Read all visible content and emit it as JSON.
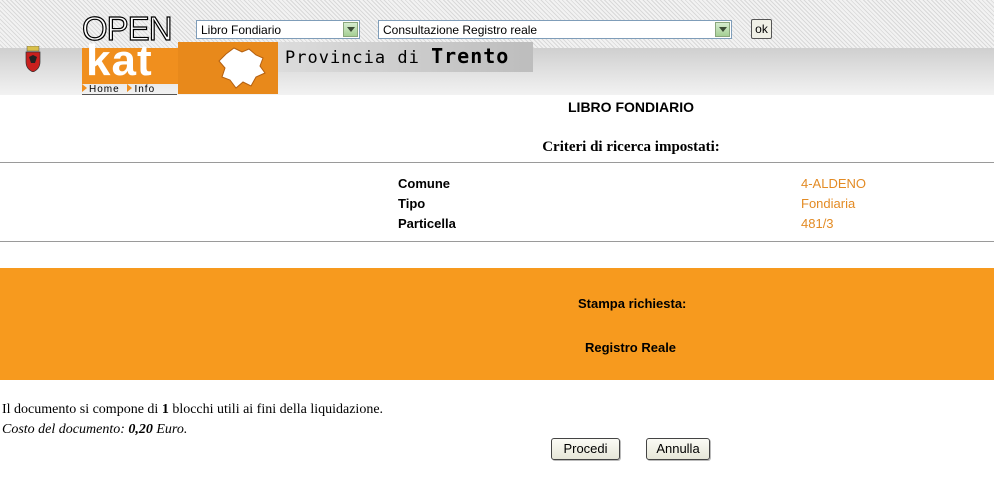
{
  "header": {
    "logo_open": "OPEN",
    "logo_kat": "kat",
    "title_prefix": "Provincia di",
    "title_main": "Trento",
    "nav": {
      "home": "Home",
      "info": "Info"
    }
  },
  "toolbar": {
    "section_select": {
      "value": "Libro Fondiario"
    },
    "query_select": {
      "value": "Consultazione Registro reale"
    },
    "ok_label": "ok"
  },
  "main": {
    "title": "LIBRO FONDIARIO",
    "criteria_heading": "Criteri di ricerca impostati:",
    "criteria": [
      {
        "label": "Comune",
        "value": "4-ALDENO"
      },
      {
        "label": "Tipo",
        "value": "Fondiaria"
      },
      {
        "label": "Particella",
        "value": "481/3"
      }
    ],
    "print": {
      "label": "Stampa richiesta:",
      "value": "Registro Reale"
    },
    "document": {
      "line_prefix": "Il documento si compone di",
      "blocks": "1",
      "line_suffix": "blocchi utili ai fini della liquidazione.",
      "cost_prefix": "Costo del documento:",
      "cost_value": "0,20",
      "cost_suffix": "Euro."
    },
    "buttons": {
      "proceed": "Procedi",
      "cancel": "Annulla"
    }
  },
  "colors": {
    "accent": "#f79a1e",
    "value_text": "#e38b24"
  }
}
